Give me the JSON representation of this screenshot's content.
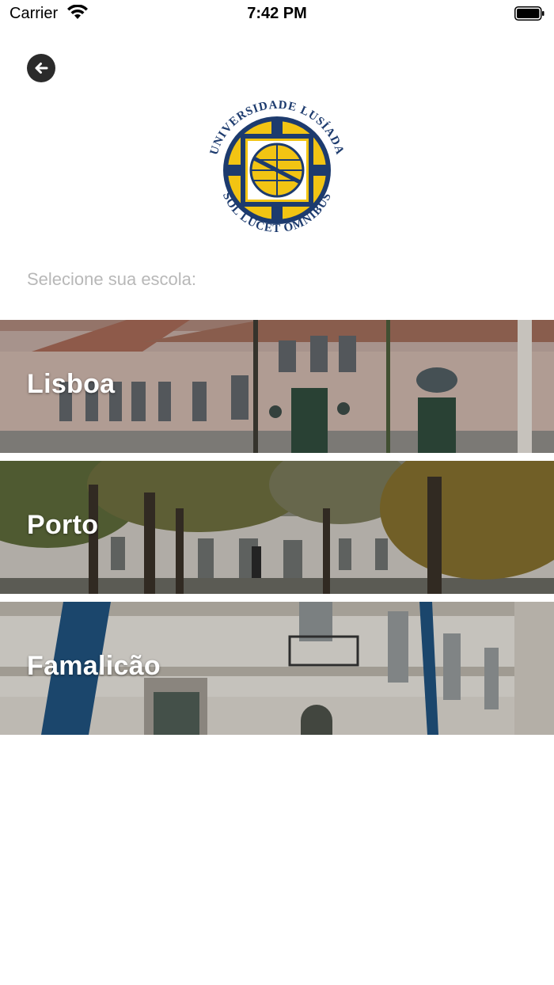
{
  "status_bar": {
    "carrier": "Carrier",
    "time": "7:42 PM",
    "icons": [
      "wifi-icon",
      "battery-icon"
    ]
  },
  "header": {
    "back_icon": "arrow-left-icon",
    "logo": {
      "top_text": "UNIVERSIDADE LUSÍADA",
      "bottom_text": "SOL LUCET OMNIBUS",
      "colors": {
        "blue": "#1d3b6e",
        "yellow": "#f2c413"
      }
    }
  },
  "main": {
    "prompt": "Selecione sua escola:",
    "schools": [
      {
        "name": "Lisboa"
      },
      {
        "name": "Porto"
      },
      {
        "name": "Famalicão"
      }
    ]
  }
}
